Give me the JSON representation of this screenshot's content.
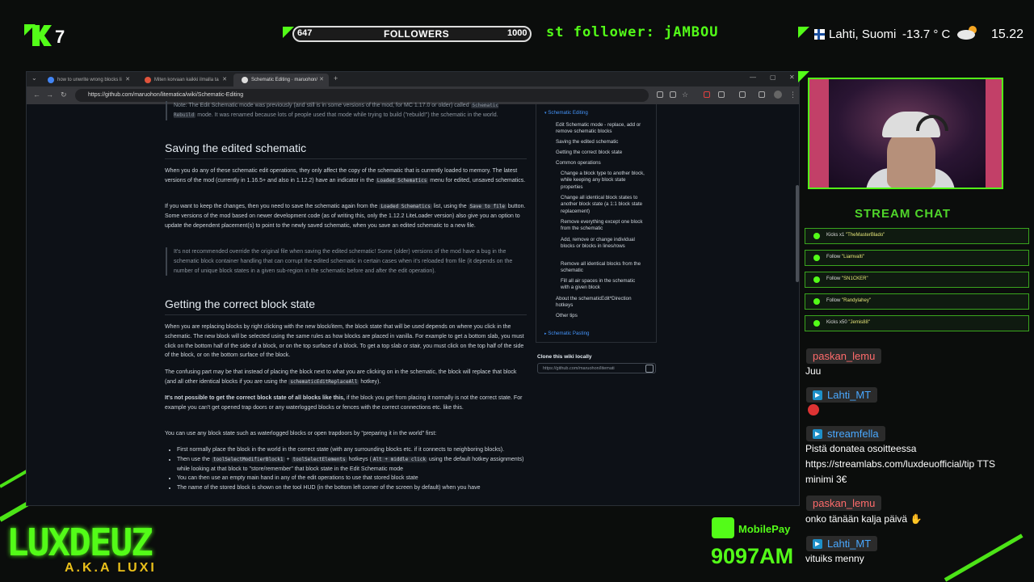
{
  "overlay": {
    "kick_count": "7",
    "followers": {
      "min": "647",
      "label": "FOLLOWERS",
      "max": "1000",
      "progress": 0.0
    },
    "ticker": "st follower: jAMBOU",
    "weather": {
      "city": "Lahti, Suomi",
      "temp": "-13.7 ° C"
    },
    "clock": "15.22",
    "accent_color": "#53fc18"
  },
  "browser": {
    "tabs": [
      {
        "label": "how to unwrite wrong blocks li"
      },
      {
        "label": "Miten korvaan kaikki ilmalla ta"
      },
      {
        "label": "Schematic Editing · maruohon/"
      }
    ],
    "url": "https://github.com/maruohon/litematica/wiki/Schematic-Editing"
  },
  "article": {
    "note_top": "Note: The Edit Schematic mode was previously (and still is in some versions of the mod, for MC 1.17.0 or older) called",
    "note_code": "Schematic Rebuild",
    "note_rest": "mode. It was renamed because lots of people used that mode while trying to build (\"rebuild!\") the schematic in the world.",
    "h_saving": "Saving the edited schematic",
    "p1a": "When you do any of these schematic edit operations, they only affect the copy of the schematic that is currently loaded to memory. The latest versions of the mod (currently in 1.16.5+ and also in 1.12.2) have an indicator in the",
    "p1code": "Loaded Schematics",
    "p1b": "menu for edited, unsaved schematics.",
    "p2a": "If you want to keep the changes, then you need to save the schematic again from the",
    "p2code1": "Loaded Schematics",
    "p2b": "list, using the",
    "p2code2": "Save to file",
    "p2c": "button. Some versions of the mod based on newer development code (as of writing this, only the 1.12.2 LiteLoader version) also give you an option to update the dependent placement(s) to point to the newly saved schematic, when you save an edited schematic to a new file.",
    "quote": "It's not recommended override the original file when saving the edited schematic! Some (older) versions of the mod have a bug in the schematic block container handling that can corrupt the edited schematic in certain cases when it's reloaded from file (it depends on the number of unique block states in a given sub-region in the schematic before and after the edit operation).",
    "h_correct": "Getting the correct block state",
    "p3": "When you are replacing blocks by right clicking with the new block/item, the block state that will be used depends on where you click in the schematic. The new block will be selected using the same rules as how blocks are placed in vanilla. For example to get a bottom slab, you must click on the bottom half of the side of a block, or on the top surface of a block. To get a top slab or stair, you must click on the top half of the side of the block, or on the bottom surface of the block.",
    "p4a": "The confusing part may be that instead of placing the block next to what you are clicking on in the schematic, the block will replace that block (and all other identical blocks if you are using the",
    "p4code": "schematicEditReplaceAll",
    "p4b": "hotkey).",
    "p5bold": "It's not possible to get the correct block state of all blocks like this,",
    "p5rest": "if the block you get from placing it normally is not the correct state. For example you can't get opened trap doors or any waterlogged blocks or fences with the correct connections etc. like this.",
    "p6": "You can use any block state such as waterlogged blocks or open trapdoors by \"preparing it in the world\" first:",
    "li1": "First normally place the block in the world in the correct state (with any surrounding blocks etc. if it connects to neighboring blocks).",
    "li2a": "Then use the",
    "li2code1": "toolSelectModifierBlock1",
    "li2plus": "+",
    "li2code2": "toolSelectElements",
    "li2b": "hotkeys (",
    "li2code3": "Alt + middle click",
    "li2c": "using the default hotkey assignments) while looking at that block to \"store/remember\" that block state in the Edit Schematic mode",
    "li3": "You can then use an empty main hand in any of the edit operations to use that stored block state",
    "li4": "The name of the stored block is shown on the tool HUD (in the bottom left corner of the screen by default) when you have"
  },
  "toc": {
    "section": "Schematic Editing",
    "items": [
      "Edit Schematic mode - replace, add or remove schematic blocks",
      "Saving the edited schematic",
      "Getting the correct block state",
      "Common operations"
    ],
    "sub": [
      "Change a block type to another block, while keeping any block state properties",
      "Change all identical block states to another block state (a 1:1 block state replacement)",
      "Remove everything except one block from the schematic",
      "Add, remove or change individual blocks or blocks in lines/rows",
      "Remove all identical blocks from the schematic",
      "Fill all air spaces in the schematic with a given block"
    ],
    "items2": [
      "About the schematicEdit*Direction hotkeys",
      "Other tips"
    ],
    "next_section": "Schematic Pasting",
    "clone_title": "Clone this wiki locally",
    "clone_url": "https://github.com/maruohon/litemati"
  },
  "chat": {
    "title": "STREAM CHAT",
    "events": [
      {
        "type": "Kicks x1",
        "user": "\"TheMasterBlado\""
      },
      {
        "type": "Follow",
        "user": "\"Liamvalti\""
      },
      {
        "type": "Follow",
        "user": "\"SN1CKER\""
      },
      {
        "type": "Follow",
        "user": "\"Randylahey\""
      },
      {
        "type": "Kicks x50",
        "user": "\"Jemis88\""
      }
    ],
    "messages": [
      {
        "user": "paskan_lemu",
        "text": "Juu",
        "color": "#ff6b6b"
      },
      {
        "user": "Lahti_MT",
        "text": "",
        "color": "#49a8ff"
      },
      {
        "user": "streamfella",
        "text": "Pistä donatea osoitteessa",
        "text2": "https://streamlabs.com/luxdeuofficial/tip TTS",
        "text3": "minimi 3€",
        "color": "#49a8ff"
      },
      {
        "user": "paskan_lemu",
        "text": "onko tänään kalja päivä",
        "color": "#ff6b6b"
      },
      {
        "user": "Lahti_MT",
        "text": "vituiks menny",
        "color": "#49a8ff"
      }
    ]
  },
  "bottom": {
    "brand": "LUXDEUZ",
    "aka": "A.K.A LUXI",
    "mobilepay_label": "MobilePay",
    "mobilepay_number": "9097AM"
  }
}
